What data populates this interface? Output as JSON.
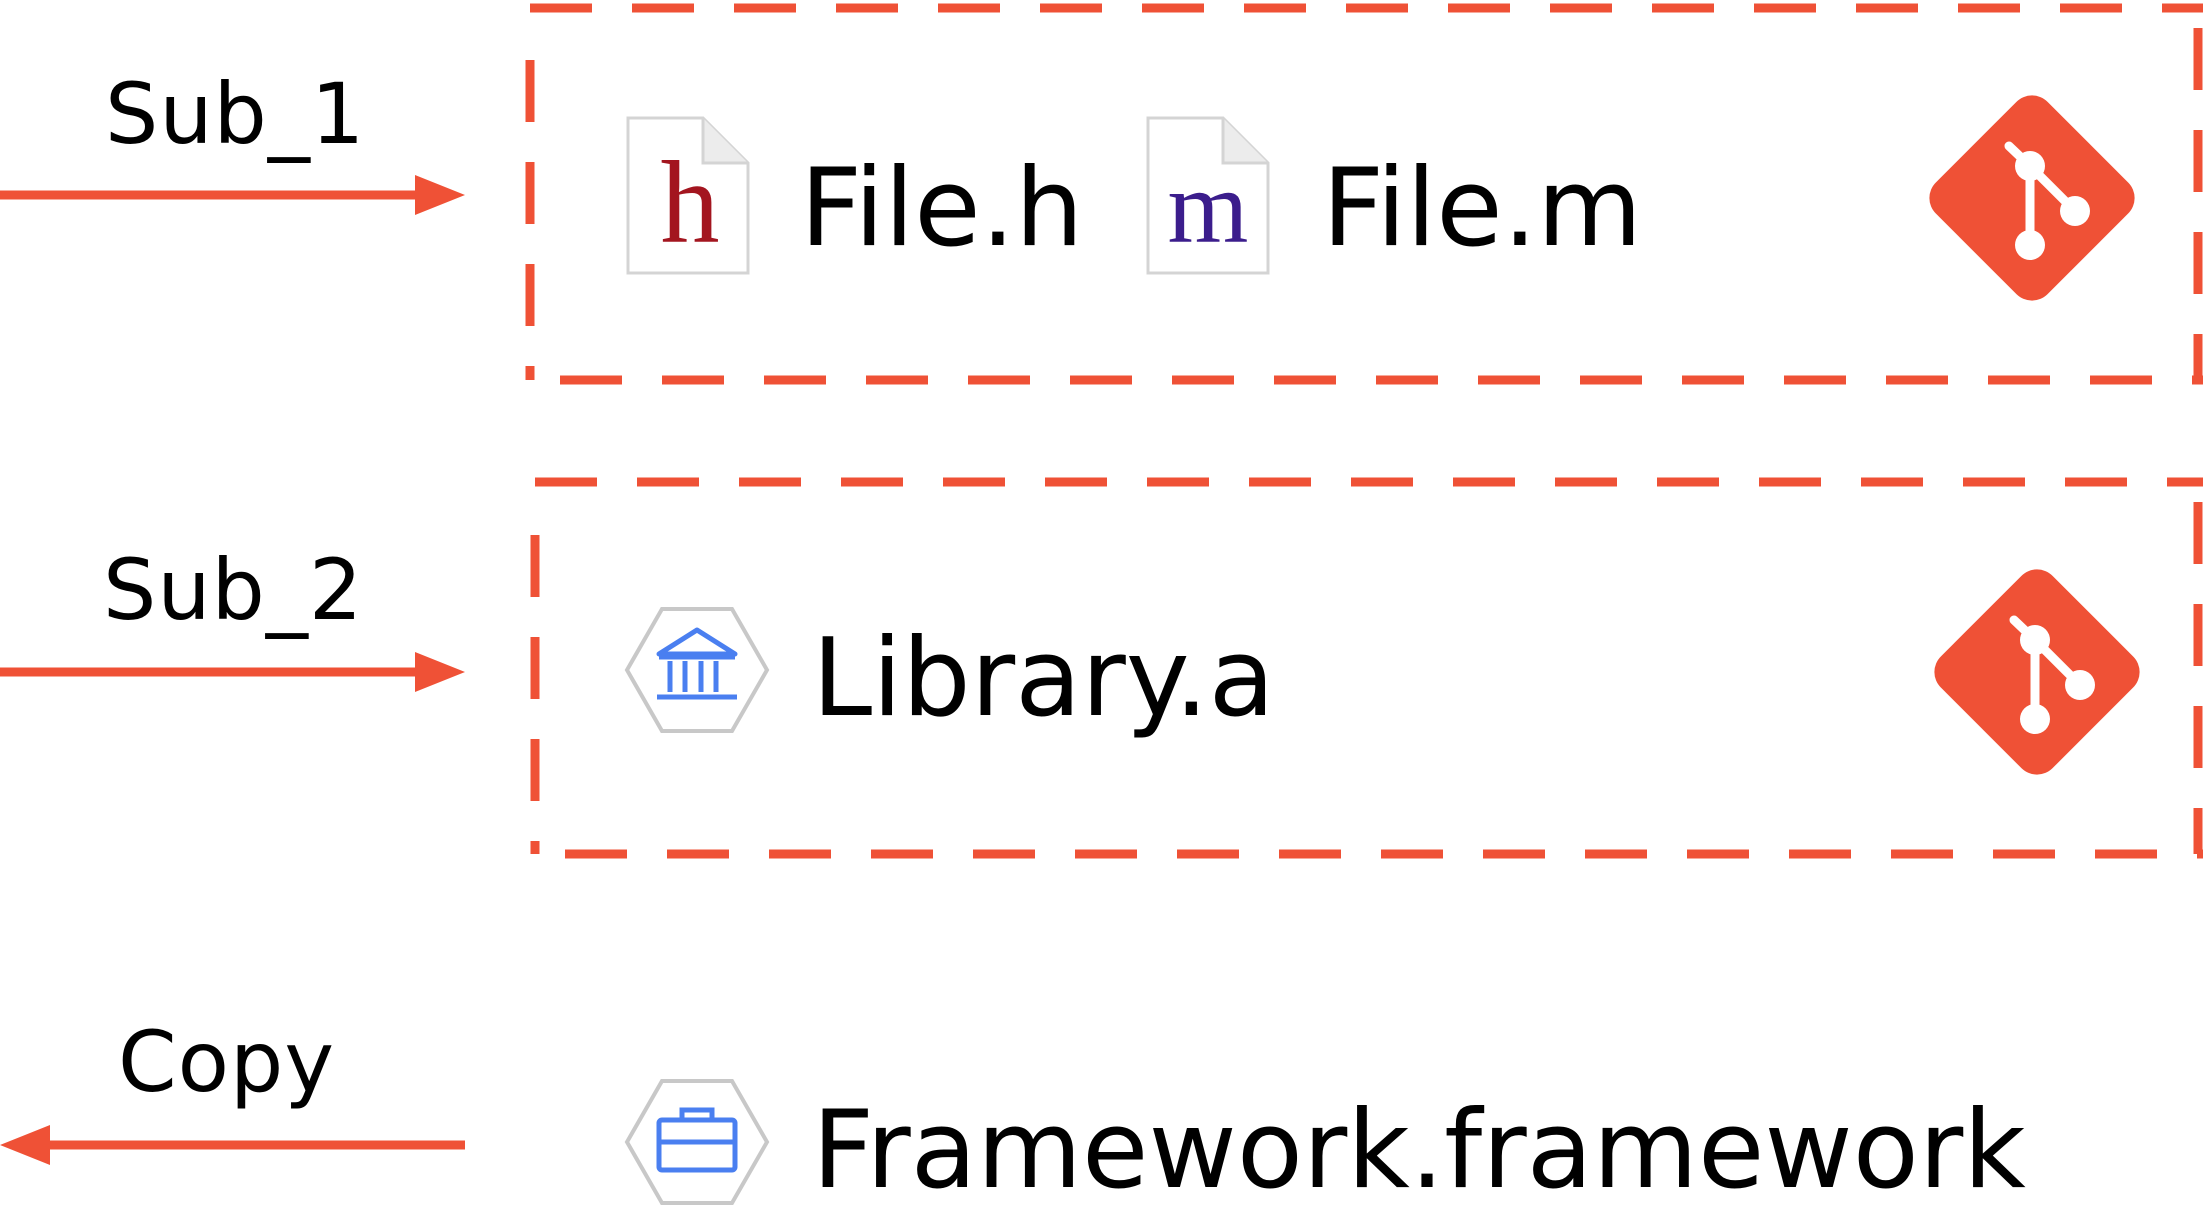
{
  "accent_color": "#ef5136",
  "arrows": [
    {
      "label": "Sub_1",
      "direction": "right"
    },
    {
      "label": "Sub_2",
      "direction": "right"
    },
    {
      "label": "Copy",
      "direction": "left"
    }
  ],
  "sub1": {
    "files": [
      {
        "name": "File.h",
        "icon": "header-file-icon",
        "letter": "h",
        "letter_color": "#a3151f"
      },
      {
        "name": "File.m",
        "icon": "objc-source-file-icon",
        "letter": "m",
        "letter_color": "#3b1d8c"
      }
    ],
    "repo_icon": "git-icon"
  },
  "sub2": {
    "files": [
      {
        "name": "Library.a",
        "icon": "library-icon"
      }
    ],
    "repo_icon": "git-icon"
  },
  "output": {
    "name": "Framework.framework",
    "icon": "framework-toolbox-icon"
  }
}
